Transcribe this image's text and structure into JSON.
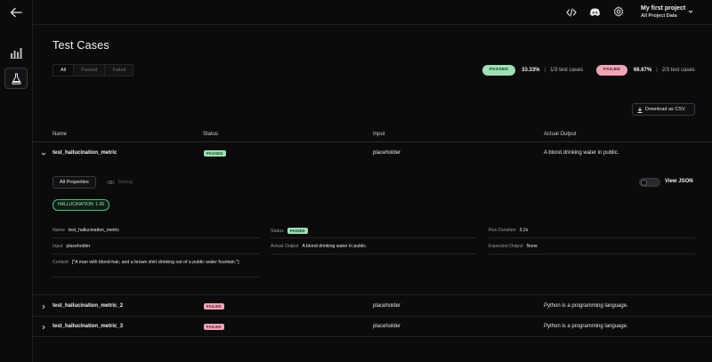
{
  "project": {
    "title": "My first project",
    "subtitle": "All Project Data"
  },
  "page": {
    "title": "Test Cases"
  },
  "filters": {
    "all": "All",
    "passed": "Passed",
    "failed": "Failed"
  },
  "summary": {
    "passed_label": "PASSED",
    "passed_pct": "33.33%",
    "passed_count": "1/3 test cases",
    "failed_label": "FAILED",
    "failed_pct": "66.67%",
    "failed_count": "2/3 test cases",
    "separator": "|"
  },
  "download_label": "Download as CSV",
  "table": {
    "headers": {
      "name": "Name",
      "status": "Status",
      "input": "Input",
      "output": "Actual Output"
    },
    "rows": [
      {
        "name": "test_hallucination_metric",
        "status": "PASSED",
        "input": "placeholder",
        "output": "A blond drinking water in public."
      },
      {
        "name": "test_hallucination_metric_2",
        "status": "FAILED",
        "input": "placeholder",
        "output": "Python is a programming language."
      },
      {
        "name": "test_hallucination_metric_3",
        "status": "FAILED",
        "input": "placeholder",
        "output": "Python is a programming language."
      }
    ]
  },
  "detail": {
    "tab_all": "All Properties",
    "tab_debug": "Debug",
    "view_json": "View JSON",
    "metric_chip": "HALLUCINATION: 1.00",
    "fields": {
      "name_k": "Name",
      "name_v": "test_hallucination_metric",
      "status_k": "Status",
      "status_v": "PASSED",
      "duration_k": "Run Duration",
      "duration_v": "3.2s",
      "input_k": "Input",
      "input_v": "placeholder",
      "actual_k": "Actual Output",
      "actual_v": "A blond drinking water in public.",
      "expected_k": "Expected Output",
      "expected_v": "None",
      "context_k": "Context",
      "context_v": "[\"A man with blond-hair, and a brown shirt drinking out of a public water fountain.\"]"
    }
  },
  "colors": {
    "passed": "#9de0b5",
    "failed": "#f0a5b6",
    "background": "#0b0b0c"
  }
}
